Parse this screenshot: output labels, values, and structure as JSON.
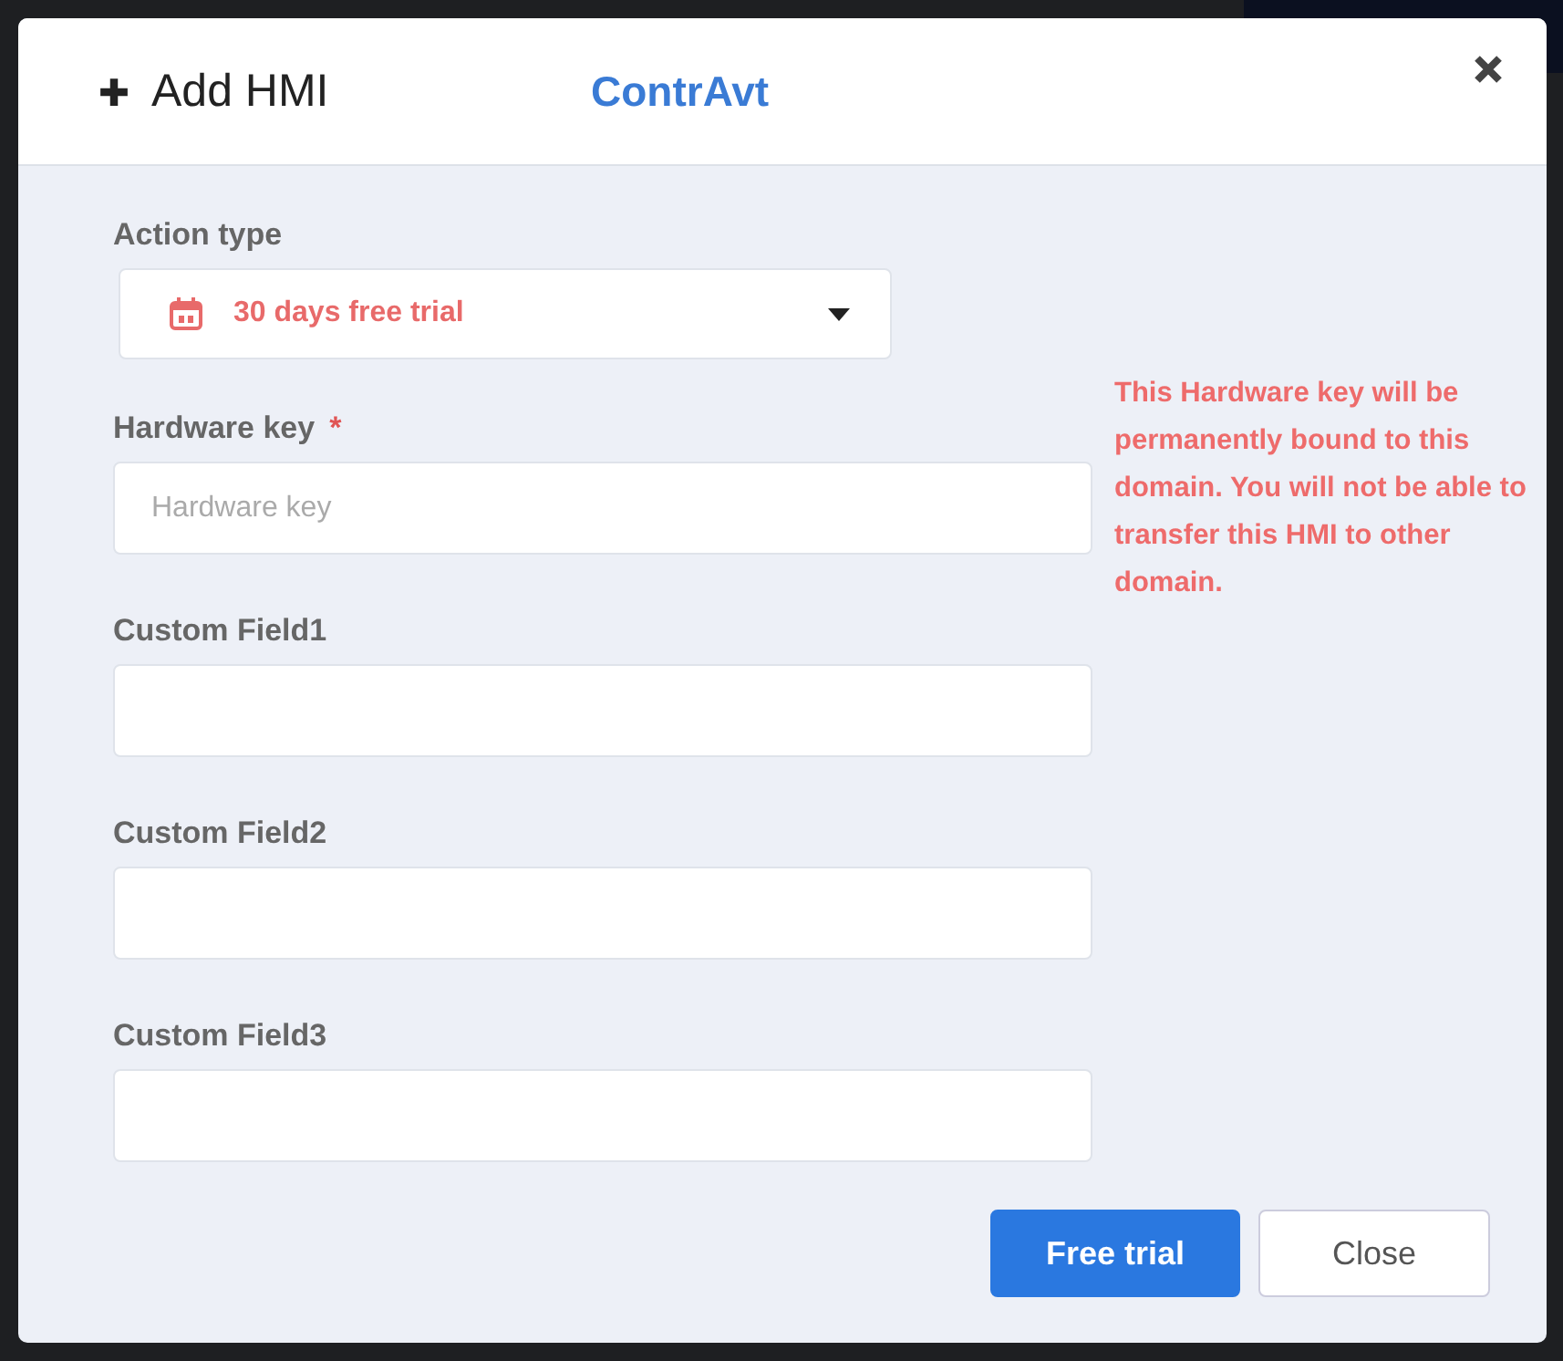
{
  "dialog": {
    "title": "Add HMI",
    "brand": "ContrAvt"
  },
  "action_type": {
    "label": "Action type",
    "value": "30 days free trial"
  },
  "fields": [
    {
      "label": "Hardware key",
      "required_mark": "*",
      "placeholder": "Hardware key"
    },
    {
      "label": "Custom Field1"
    },
    {
      "label": "Custom Field2"
    },
    {
      "label": "Custom Field3"
    }
  ],
  "warning": "This Hardware key will be permanently bound to this domain. You will not be able to transfer this HMI to other domain.",
  "buttons": [
    {
      "label": "Free trial",
      "kind": "primary"
    },
    {
      "label": "Close",
      "kind": "secondary"
    }
  ]
}
